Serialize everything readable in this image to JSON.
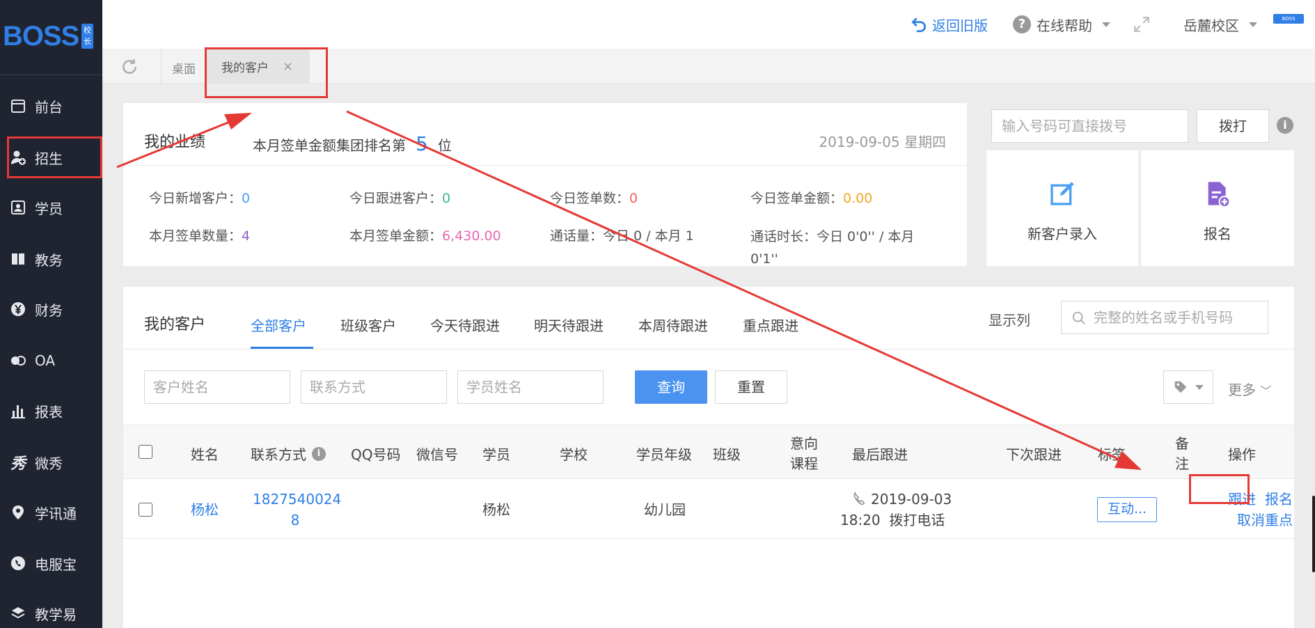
{
  "app": {
    "logo": "BOSS",
    "logo_badge": "校长"
  },
  "sidebar": {
    "items": [
      {
        "label": "前台",
        "icon": "calendar-icon"
      },
      {
        "label": "招生",
        "icon": "add-user-icon"
      },
      {
        "label": "学员",
        "icon": "id-card-icon"
      },
      {
        "label": "教务",
        "icon": "book-icon"
      },
      {
        "label": "财务",
        "icon": "yen-icon"
      },
      {
        "label": "OA",
        "icon": "chat-bubbles-icon"
      },
      {
        "label": "报表",
        "icon": "bar-chart-icon"
      },
      {
        "label": "微秀",
        "icon": "xiu-icon"
      },
      {
        "label": "学讯通",
        "icon": "location-icon"
      },
      {
        "label": "电服宝",
        "icon": "phone-icon"
      },
      {
        "label": "教学易",
        "icon": "layers-icon"
      }
    ]
  },
  "topbar": {
    "back_label": "返回旧版",
    "help_label": "在线帮助",
    "campus_label": "岳麓校区",
    "avatar_text": "BOSS"
  },
  "tabs": {
    "desktop": "桌面",
    "active": "我的客户",
    "close": "×"
  },
  "performance": {
    "title": "我的业绩",
    "rank_prefix": "本月签单金额集团排名第",
    "rank_value": "5",
    "rank_suffix": "位",
    "date": "2019-09-05 星期四",
    "stats": [
      {
        "label": "今日新增客户：",
        "value": "0"
      },
      {
        "label": "今日跟进客户：",
        "value": "0"
      },
      {
        "label": "今日签单数：",
        "value": "0"
      },
      {
        "label": "今日签单金额：",
        "value": "0.00"
      },
      {
        "label": "本月签单数量：",
        "value": "4"
      },
      {
        "label": "本月签单金额：",
        "value": "6,430.00"
      },
      {
        "label": "通话量：",
        "value": "今日 0 / 本月 1"
      },
      {
        "label": "通话时长：",
        "value_line1": "今日 0'0'' / 本月",
        "value_line2": "0'1''"
      }
    ]
  },
  "dial": {
    "placeholder": "输入号码可直接拨号",
    "button": "拨打",
    "quick_actions": [
      {
        "label": "新客户录入",
        "icon": "edit-icon",
        "color": "#4a9ff5"
      },
      {
        "label": "报名",
        "icon": "document-add-icon",
        "color": "#8a63d2"
      }
    ]
  },
  "customers": {
    "title": "我的客户",
    "tabs": [
      "全部客户",
      "班级客户",
      "今天待跟进",
      "明天待跟进",
      "本周待跟进",
      "重点跟进"
    ],
    "show_columns": "显示列",
    "search_placeholder": "完整的姓名或手机号码",
    "filters": {
      "name": "客户姓名",
      "contact": "联系方式",
      "student": "学员姓名"
    },
    "query": "查询",
    "reset": "重置",
    "more": "更多",
    "columns": {
      "name": "姓名",
      "contact": "联系方式",
      "qq": "QQ号码",
      "wechat": "微信号",
      "student": "学员",
      "school": "学校",
      "grade": "学员年级",
      "class": "班级",
      "intent_1": "意向",
      "intent_2": "课程",
      "last_follow": "最后跟进",
      "next_follow": "下次跟进",
      "tags": "标签",
      "remark_1": "备",
      "remark_2": "注",
      "action": "操作"
    },
    "rows": [
      {
        "name": "杨松",
        "phone_1": "1827540024",
        "phone_2": "8",
        "student": "杨松",
        "grade": "幼儿园",
        "last_follow_date": "2019-09-03",
        "last_follow_time": "18:20",
        "last_follow_type": "拨打电话",
        "tag": "互动...",
        "action_follow": "跟进",
        "action_enroll": "报名",
        "action_cancel": "取消重点"
      }
    ]
  },
  "colors": {
    "accent": "#2f7fe6",
    "sidebar": "#1f2430",
    "annotation": "#e53935"
  }
}
